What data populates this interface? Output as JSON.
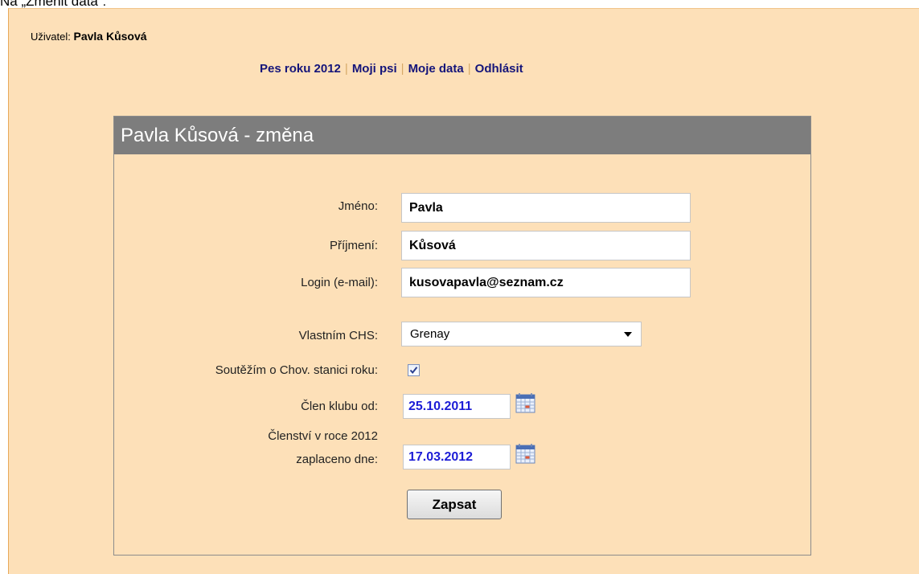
{
  "caption": "Na „Změnit data“:",
  "user": {
    "label": "Uživatel:",
    "name": "Pavla Kůsová"
  },
  "nav": {
    "items": [
      "Pes roku 2012",
      "Moji psi",
      "Moje data",
      "Odhlásit"
    ],
    "separator": "|"
  },
  "form": {
    "title": "Pavla Kůsová - změna",
    "fields": {
      "first_name": {
        "label": "Jméno:",
        "value": "Pavla"
      },
      "last_name": {
        "label": "Příjmení:",
        "value": "Kůsová"
      },
      "login": {
        "label": "Login (e-mail):",
        "value": "kusovapavla@seznam.cz"
      },
      "kennel": {
        "label": "Vlastním CHS:",
        "value": "Grenay"
      },
      "competition": {
        "label": "Soutěžím o Chov. stanici roku:",
        "checked": true
      },
      "member_since": {
        "label": "Člen klubu  od:",
        "value": "25.10.2011"
      },
      "membership_paid": {
        "label_line1": "Členství v roce 2012",
        "label_line2": "zaplaceno dne:",
        "value": "17.03.2012"
      }
    },
    "submit_label": "Zapsat"
  },
  "colors": {
    "page_background": "#fde0b8",
    "header_bar": "#7d7d7d",
    "nav_link": "#15157a",
    "date_value": "#1c1cd6"
  },
  "icons": [
    "calendar-icon",
    "checkmark-icon",
    "chevron-down-icon"
  ]
}
